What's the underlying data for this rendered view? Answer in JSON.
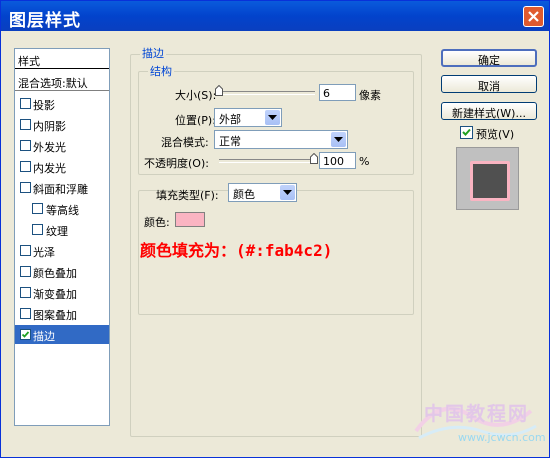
{
  "window": {
    "title": "图层样式"
  },
  "stylelist": {
    "header": "样式",
    "blend": "混合选项:默认",
    "items": [
      {
        "label": "投影",
        "checked": false,
        "indent": false
      },
      {
        "label": "内阴影",
        "checked": false,
        "indent": false
      },
      {
        "label": "外发光",
        "checked": false,
        "indent": false
      },
      {
        "label": "内发光",
        "checked": false,
        "indent": false
      },
      {
        "label": "斜面和浮雕",
        "checked": false,
        "indent": false
      },
      {
        "label": "等高线",
        "checked": false,
        "indent": true
      },
      {
        "label": "纹理",
        "checked": false,
        "indent": true
      },
      {
        "label": "光泽",
        "checked": false,
        "indent": false
      },
      {
        "label": "颜色叠加",
        "checked": false,
        "indent": false
      },
      {
        "label": "渐变叠加",
        "checked": false,
        "indent": false
      },
      {
        "label": "图案叠加",
        "checked": false,
        "indent": false
      },
      {
        "label": "描边",
        "checked": true,
        "indent": false,
        "selected": true
      }
    ]
  },
  "buttons": {
    "ok": "确定",
    "cancel": "取消",
    "new_style": "新建样式(W)...",
    "preview": "预览(V)"
  },
  "stroke": {
    "section_title": "描边",
    "structure_title": "结构",
    "size_label": "大小(S):",
    "size_value": "6",
    "size_unit": "像素",
    "position_label": "位置(P):",
    "position_value": "外部",
    "blend_label": "混合模式:",
    "blend_value": "正常",
    "opacity_label": "不透明度(O):",
    "opacity_value": "100",
    "opacity_unit": "%",
    "fill_type_label": "填充类型(F):",
    "fill_type_value": "颜色",
    "color_label": "颜色:",
    "color_hex": "#fab4c2"
  },
  "annotation": "颜色填充为：(#:fab4c2)",
  "watermark": {
    "text": "中国教程网",
    "url": "www.jcwcn.com"
  },
  "colors": {
    "title_bar": "#0a5bdc",
    "selected": "#316ac5",
    "annotation": "#ff0000",
    "swatch": "#fab4c2"
  }
}
